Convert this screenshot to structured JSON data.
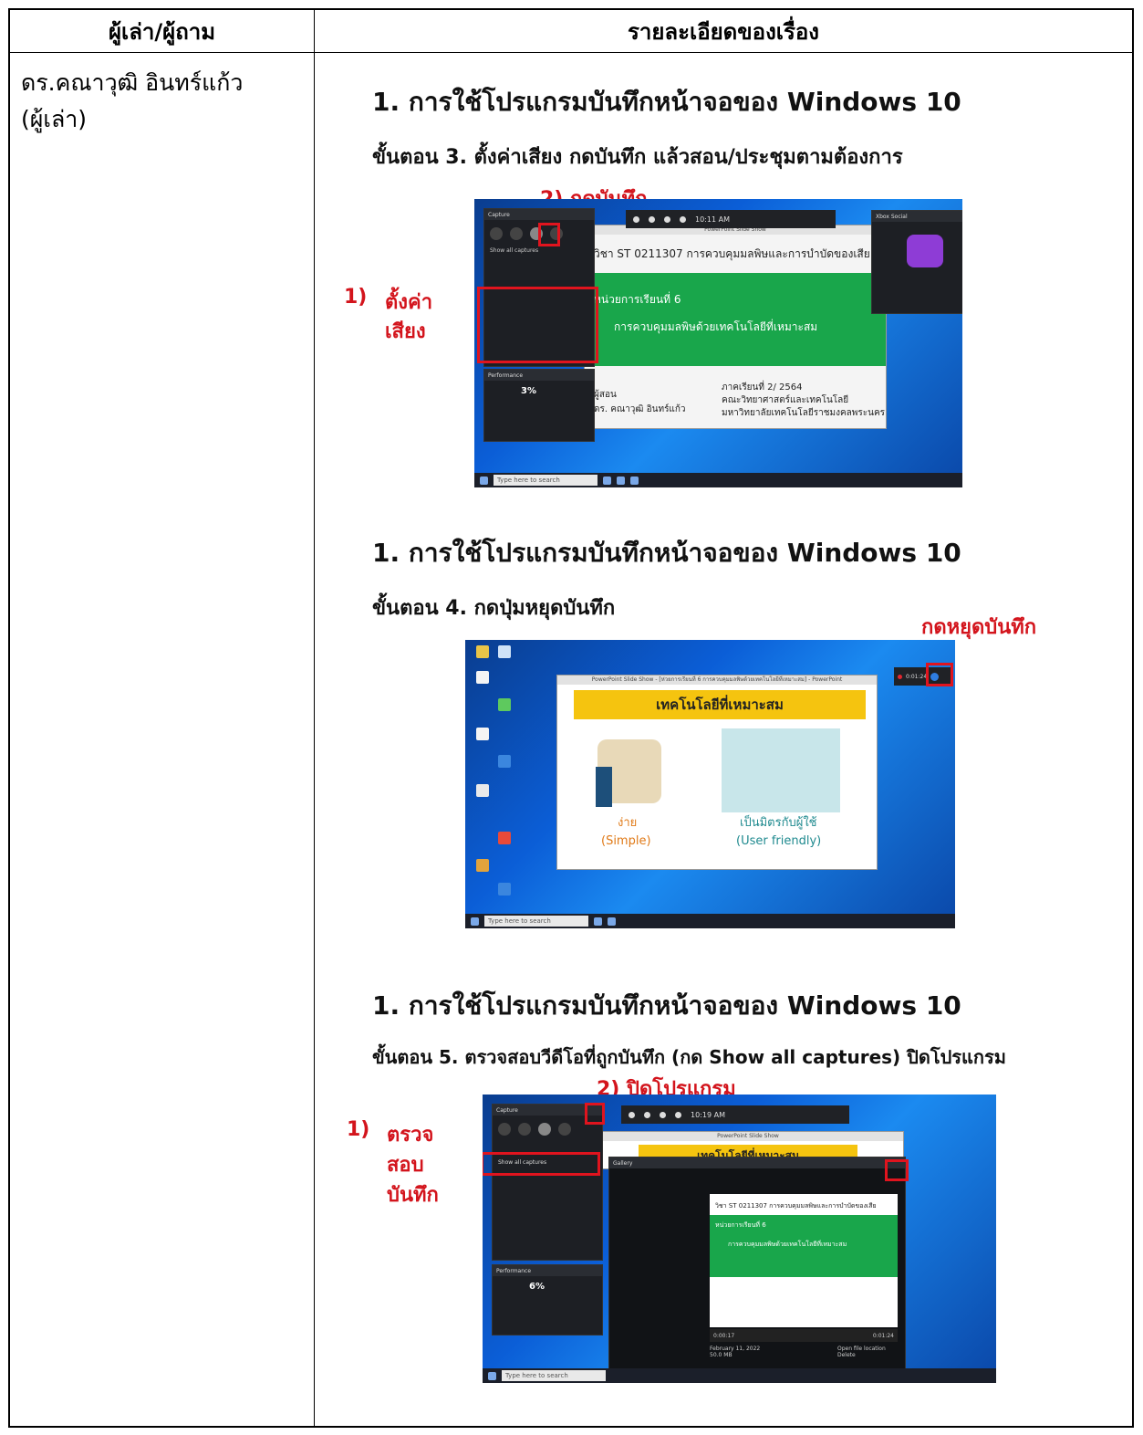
{
  "table": {
    "header_left": "ผู้เล่า/ผู้ถาม",
    "header_right": "รายละเอียดของเรื่อง",
    "narrator_line1": "ดร.คณาวุฒิ  อินทร์แก้ว",
    "narrator_line2": "(ผู้เล่า)"
  },
  "sections": [
    {
      "title": "1.  การใช้โปรแกรมบันทึกหน้าจอของ Windows 10",
      "step": "ขั้นตอน  3. ตั้งค่าเสียง  กดบันทึก  แล้วสอน/ประชุมตามต้องการ",
      "notes": [
        "2) กดบันทึก",
        "1)",
        "ตั้งค่า",
        "เสียง"
      ],
      "screenshot": {
        "gamebar_time": "10:11 AM",
        "slide_course": "วิชา ST 0211307 การควบคุมมลพิษและการบำบัดของเสีย",
        "slide_unit": "หน่วยการเรียนที่ 6",
        "slide_topic": "การควบคุมมลพิษด้วยเทคโนโลยีที่เหมาะสม",
        "slide_author_label": "ผู้สอน",
        "slide_author": "ดร. คณาวุฒิ  อินทร์แก้ว",
        "slide_term": "ภาคเรียนที่ 2/ 2564",
        "slide_faculty": "คณะวิทยาศาสตร์และเทคโนโลยี",
        "slide_univ": "มหาวิทยาลัยเทคโนโลยีราชมงคลพระนคร",
        "capture_label": "Capture",
        "show_all": "Show all captures",
        "perf_label": "Performance",
        "cpu": "3%",
        "xbox_label": "Xbox Social",
        "search": "Type here to search"
      }
    },
    {
      "title": "1.  การใช้โปรแกรมบันทึกหน้าจอของ Windows 10",
      "step": "ขั้นตอน  4. กดปุ่มหยุดบันทึก",
      "notes": [
        "กดหยุดบันทึก"
      ],
      "screenshot": {
        "ppt_title": "PowerPoint Slide Show - [ห่วยการเรียนที่ 6 การควบคุมมลพิษด้วยเทคโนโลยีที่เหมาะสม] - PowerPoint",
        "slide_header": "เทคโนโลยีที่เหมาะสม",
        "item1_th": "ง่าย",
        "item1_en": "(Simple)",
        "item2_th": "เป็นมิตรกับผู้ใช้",
        "item2_en": "(User friendly)",
        "rec_time": "0:01:24",
        "search": "Type here to search"
      }
    },
    {
      "title": "1.  การใช้โปรแกรมบันทึกหน้าจอของ Windows 10",
      "step": "ขั้นตอน  5. ตรวจสอบวีดีโอที่ถูกบันทึก (กด Show all captures)  ปิดโปรแกรม",
      "notes": [
        "2) ปิดโปรแกรม",
        "1)",
        "ตรวจ",
        "สอบ",
        "บันทึก"
      ],
      "screenshot": {
        "gamebar_time": "10:19 AM",
        "capture_label": "Capture",
        "show_all": "Show all captures",
        "gallery_label": "Gallery",
        "perf_label": "Performance",
        "cpu": "6%",
        "slide_header": "เทคโนโลยีที่เหมาะสม",
        "course": "วิชา ST 0211307 การควบคุมมลพิษและการบำบัดของเสีย",
        "unit": "หน่วยการเรียนที่ 6",
        "topic": "การควบคุมมลพิษด้วยเทคโนโลยีที่เหมาะสม",
        "video_start": "0:00:17",
        "video_end": "0:01:24",
        "file_date": "February 11, 2022",
        "file_size": "50.0 MB",
        "open_file": "Open file location",
        "delete": "Delete",
        "search": "Type here to search"
      }
    }
  ],
  "colors": {
    "accent_red": "#d3141c",
    "slide_green": "#19a64b",
    "slide_yellow": "#f5c40f"
  }
}
